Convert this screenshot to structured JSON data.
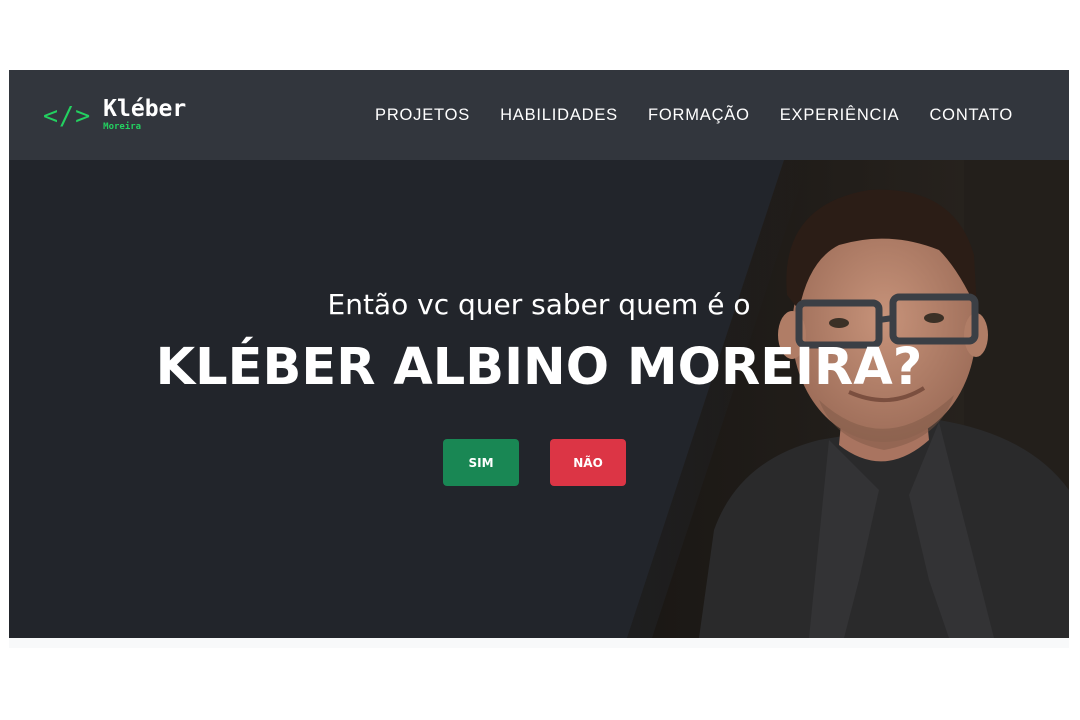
{
  "brand": {
    "icon": "</>",
    "name": "Kléber",
    "subname": "Moreira",
    "accent_color": "#23d160"
  },
  "nav": {
    "links": [
      "PROJETOS",
      "HABILIDADES",
      "FORMAÇÃO",
      "EXPERIÊNCIA",
      "CONTATO"
    ]
  },
  "hero": {
    "subtitle": "Então vc quer saber quem é o",
    "title": "KLÉBER ALBINO MOREIRA?",
    "yes_label": "SIM",
    "no_label": "NÃO",
    "yes_color": "#198754",
    "no_color": "#dc3545"
  }
}
